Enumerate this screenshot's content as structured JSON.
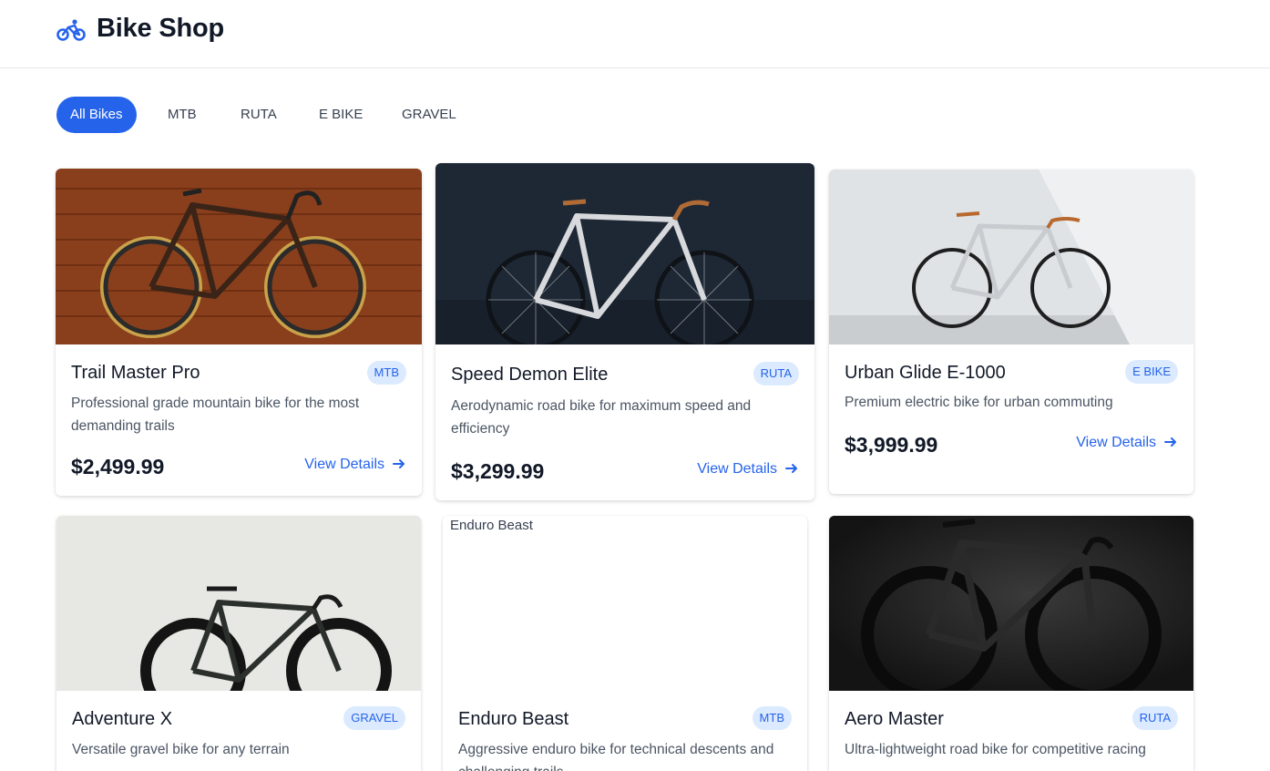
{
  "header": {
    "title": "Bike Shop",
    "logo_icon": "bicycle-icon",
    "accent": "#2563eb"
  },
  "filters": [
    {
      "label": "All Bikes",
      "active": true
    },
    {
      "label": "MTB",
      "active": false
    },
    {
      "label": "RUTA",
      "active": false
    },
    {
      "label": "E BIKE",
      "active": false
    },
    {
      "label": "GRAVEL",
      "active": false
    }
  ],
  "products": [
    {
      "name": "Trail Master Pro",
      "category": "MTB",
      "description": "Professional grade mountain bike for the most demanding trails",
      "price": "$2,499.99",
      "cta": "View Details"
    },
    {
      "name": "Speed Demon Elite",
      "category": "RUTA",
      "description": "Aerodynamic road bike for maximum speed and efficiency",
      "price": "$3,299.99",
      "cta": "View Details"
    },
    {
      "name": "Urban Glide E-1000",
      "category": "E BIKE",
      "description": "Premium electric bike for urban commuting",
      "price": "$3,999.99",
      "cta": "View Details"
    },
    {
      "name": "Adventure X",
      "category": "GRAVEL",
      "description": "Versatile gravel bike for any terrain"
    },
    {
      "name": "Enduro Beast",
      "category": "MTB",
      "description": "Aggressive enduro bike for technical descents and challenging trails",
      "image_alt": "Enduro Beast"
    },
    {
      "name": "Aero Master",
      "category": "RUTA",
      "description": "Ultra-lightweight road bike for competitive racing"
    }
  ]
}
